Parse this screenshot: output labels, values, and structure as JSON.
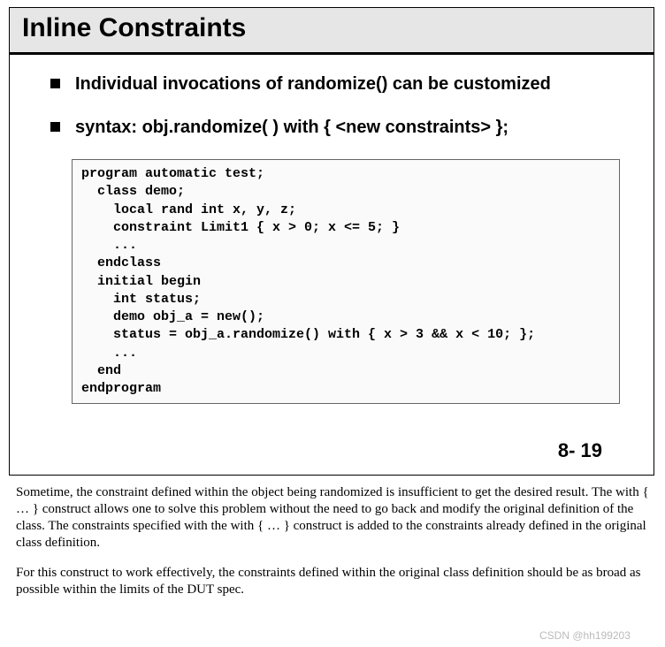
{
  "slide": {
    "title": "Inline Constraints",
    "bullets": [
      "Individual invocations of randomize() can be customized",
      "syntax: obj.randomize( ) with { <new constraints> };"
    ],
    "code": "program automatic test;\n  class demo;\n    local rand int x, y, z;\n    constraint Limit1 { x > 0; x <= 5; }\n    ...\n  endclass\n  initial begin\n    int status;\n    demo obj_a = new();\n    status = obj_a.randomize() with { x > 3 && x < 10; };\n    ...\n  end\nendprogram",
    "page_number": "8- 19"
  },
  "notes": {
    "p1": "Sometime, the constraint defined within the object being randomized is insufficient to get the desired result.  The with { … } construct allows one to solve this problem without the need to go back and modify the original definition of the class.  The constraints specified with the with { … } construct is added to the constraints already defined in the original class definition.",
    "p2": "For this construct to work effectively, the constraints defined within the original class definition should be as broad as possible within the limits of the DUT spec."
  },
  "watermark": "CSDN @hh199203"
}
